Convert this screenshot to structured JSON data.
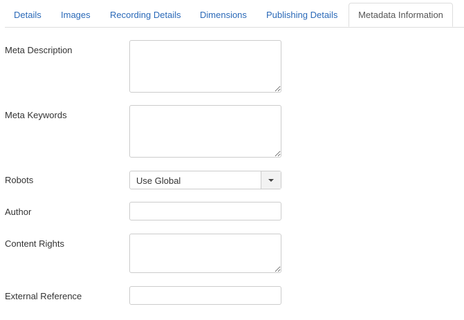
{
  "tabs": [
    {
      "label": "Details"
    },
    {
      "label": "Images"
    },
    {
      "label": "Recording Details"
    },
    {
      "label": "Dimensions"
    },
    {
      "label": "Publishing Details"
    },
    {
      "label": "Metadata Information",
      "active": true
    }
  ],
  "fields": {
    "meta_description": {
      "label": "Meta Description",
      "value": ""
    },
    "meta_keywords": {
      "label": "Meta Keywords",
      "value": ""
    },
    "robots": {
      "label": "Robots",
      "value": "Use Global"
    },
    "author": {
      "label": "Author",
      "value": ""
    },
    "content_rights": {
      "label": "Content Rights",
      "value": ""
    },
    "external_reference": {
      "label": "External Reference",
      "value": ""
    }
  },
  "colors": {
    "link": "#2a69b8",
    "border": "#dddddd"
  }
}
